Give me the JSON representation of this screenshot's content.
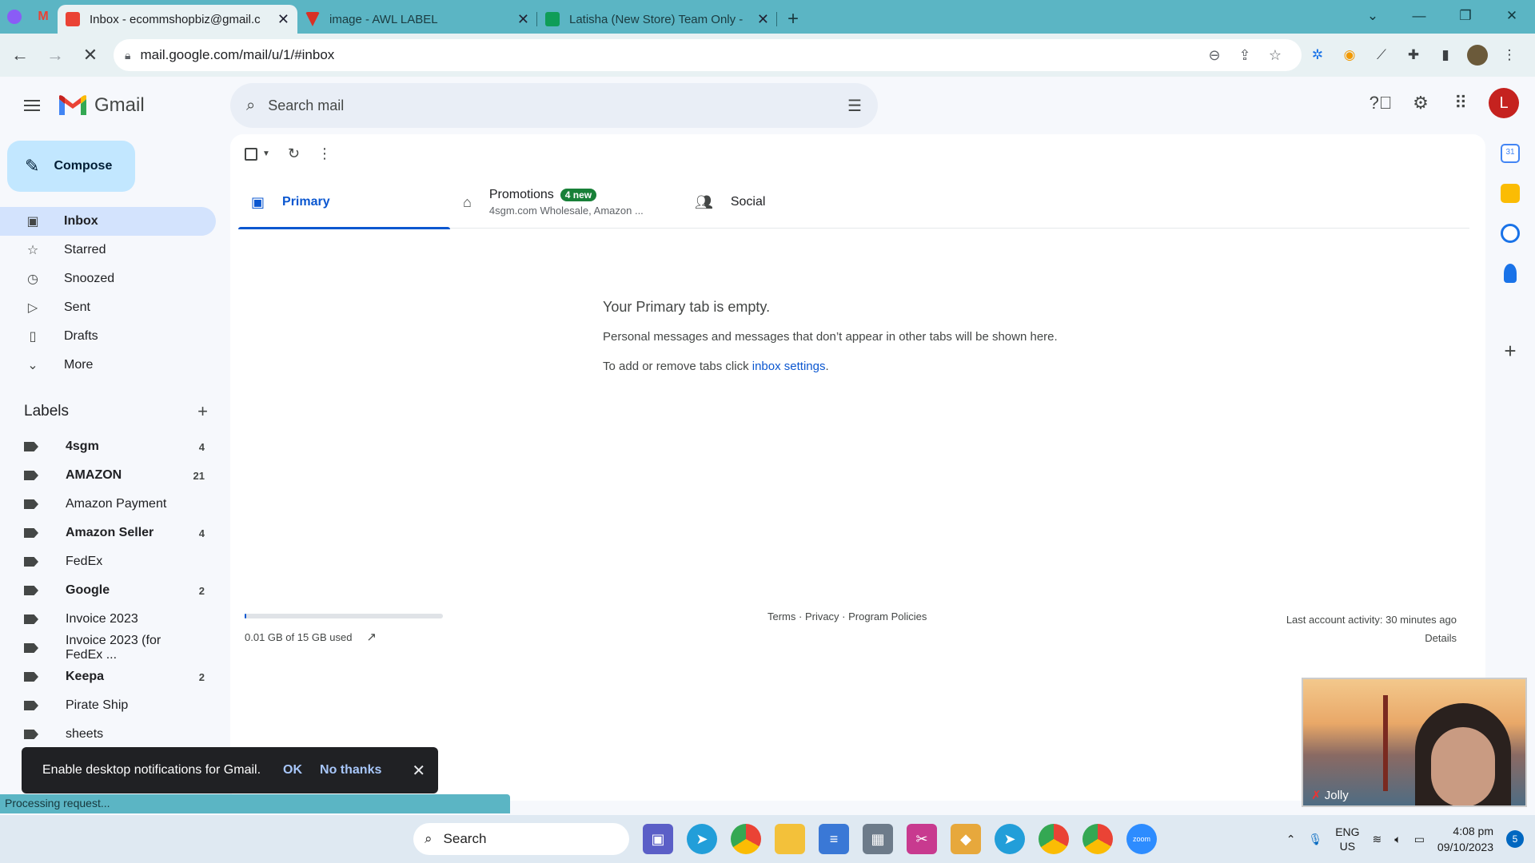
{
  "browser": {
    "tabs": [
      {
        "title": "Inbox - ecommshopbiz@gmail.c",
        "active": true,
        "favicon_color": "#ea4335"
      },
      {
        "title": "image - AWL LABEL",
        "active": false,
        "favicon_color": "#d93025"
      },
      {
        "title": "Latisha (New Store) Team Only -",
        "active": false,
        "favicon_color": "#0f9d58"
      }
    ],
    "url": "mail.google.com/mail/u/1/#inbox"
  },
  "gmail": {
    "brand": "Gmail",
    "search_placeholder": "Search mail",
    "avatar_letter": "L",
    "compose_label": "Compose",
    "nav": [
      {
        "label": "Inbox",
        "icon": "inbox-icon",
        "selected": true
      },
      {
        "label": "Starred",
        "icon": "star-icon"
      },
      {
        "label": "Snoozed",
        "icon": "clock-icon"
      },
      {
        "label": "Sent",
        "icon": "send-icon"
      },
      {
        "label": "Drafts",
        "icon": "draft-icon"
      },
      {
        "label": "More",
        "icon": "chevron-down-icon"
      }
    ],
    "labels_title": "Labels",
    "labels": [
      {
        "name": "4sgm",
        "count": "4",
        "bold": true
      },
      {
        "name": "AMAZON",
        "count": "21",
        "bold": true
      },
      {
        "name": "Amazon Payment",
        "count": "",
        "bold": false
      },
      {
        "name": "Amazon Seller",
        "count": "4",
        "bold": true
      },
      {
        "name": "FedEx",
        "count": "",
        "bold": false
      },
      {
        "name": "Google",
        "count": "2",
        "bold": true
      },
      {
        "name": "Invoice 2023",
        "count": "",
        "bold": false
      },
      {
        "name": "Invoice 2023 (for FedEx ...",
        "count": "",
        "bold": false
      },
      {
        "name": "Keepa",
        "count": "2",
        "bold": true
      },
      {
        "name": "Pirate Ship",
        "count": "",
        "bold": false
      },
      {
        "name": "sheets",
        "count": "",
        "bold": false
      }
    ],
    "tabs": {
      "primary": "Primary",
      "promotions": "Promotions",
      "promotions_badge": "4 new",
      "promotions_sub": "4sgm.com Wholesale, Amazon ...",
      "social": "Social"
    },
    "empty": {
      "heading": "Your Primary tab is empty.",
      "line1": "Personal messages and messages that don’t appear in other tabs will be shown here.",
      "line2_prefix": "To add or remove tabs click ",
      "line2_link": "inbox settings",
      "line2_suffix": "."
    },
    "storage": {
      "text": "0.01 GB of 15 GB used",
      "fill_fraction": 0.001
    },
    "footer_links": "Terms · Privacy · Program Policies",
    "activity": "Last account activity: 30 minutes ago",
    "details": "Details"
  },
  "notification": {
    "text": "Enable desktop notifications for Gmail.",
    "ok": "OK",
    "no": "No thanks"
  },
  "status_text": "Processing request...",
  "video": {
    "name": "Jolly"
  },
  "taskbar": {
    "search": "Search",
    "lang1": "ENG",
    "lang2": "US",
    "time": "4:08 pm",
    "date": "09/10/2023",
    "notif_count": "5"
  }
}
